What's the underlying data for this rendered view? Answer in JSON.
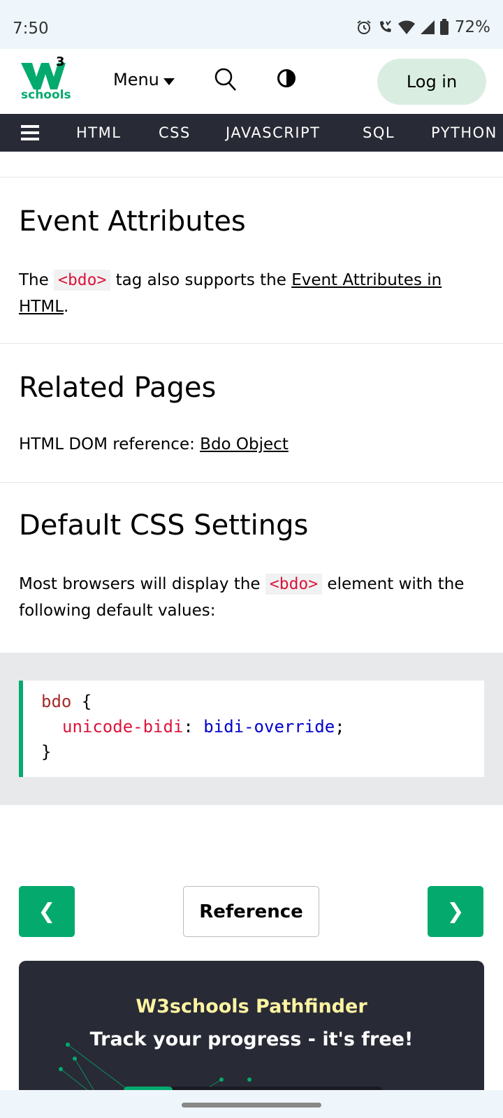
{
  "status_bar": {
    "time": "7:50",
    "battery": "72%",
    "icons": [
      "alarm-icon",
      "wifi-call-icon",
      "wifi-icon",
      "signal-icon",
      "battery-icon"
    ]
  },
  "header": {
    "logo_text": "schools",
    "logo_superscript": "3",
    "menu_label": "Menu",
    "login_label": "Log in",
    "brand_color": "#04aa6d"
  },
  "topnav": {
    "items": [
      "HTML",
      "CSS",
      "JAVASCRIPT",
      "SQL",
      "PYTHON"
    ]
  },
  "sections": {
    "event": {
      "title": "Event Attributes",
      "text_before": "The ",
      "tag": "<bdo>",
      "text_middle": " tag also supports the ",
      "link": "Event Attributes in HTML",
      "text_after": "."
    },
    "related": {
      "title": "Related Pages",
      "text": "HTML DOM reference: ",
      "link": "Bdo Object"
    },
    "default_css": {
      "title": "Default CSS Settings",
      "text_before": "Most browsers will display the ",
      "tag": "<bdo>",
      "text_after": " element with the following default values:"
    }
  },
  "code_example": {
    "selector": "bdo",
    "open_brace": " {",
    "property": "unicode-bidi",
    "colon": ": ",
    "value": "bidi-override",
    "semicolon": ";",
    "close_brace": "}"
  },
  "navigation": {
    "prev": "❮",
    "reference": "Reference",
    "next": "❯"
  },
  "pathfinder": {
    "title": "W3schools Pathfinder",
    "subtitle": "Track your progress - it's free!",
    "progress": 0.19
  }
}
